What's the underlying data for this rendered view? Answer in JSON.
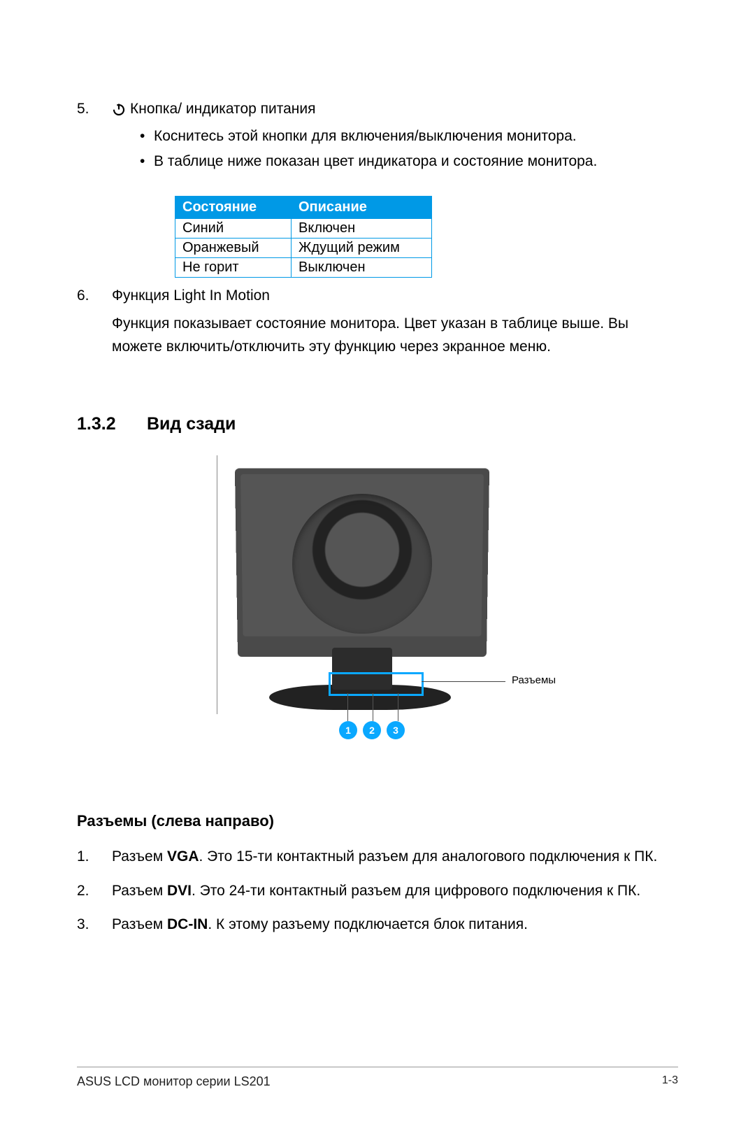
{
  "item5": {
    "num": "5.",
    "title": "Кнопка/ индикатор питания",
    "bullets": [
      "Коснитесь этой кнопки для включения/выключения монитора.",
      "В таблице ниже показан цвет индикатора и состояние монитора."
    ]
  },
  "table": {
    "headers": [
      "Состояние",
      "Описание"
    ],
    "rows": [
      [
        "Синий",
        "Включен"
      ],
      [
        "Оранжевый",
        "Ждущий режим"
      ],
      [
        "Не горит",
        "Выключен"
      ]
    ]
  },
  "item6": {
    "num": "6.",
    "title": "Функция Light In Motion",
    "desc": "Функция показывает состояние монитора. Цвет указан в таблице выше. Вы можете включить/отключить эту функцию через экранное меню."
  },
  "section": {
    "num": "1.3.2",
    "title": "Вид сзади"
  },
  "figure": {
    "callout": "Разъемы",
    "nums": [
      "1",
      "2",
      "3"
    ]
  },
  "connectors": {
    "heading": "Разъемы (слева направо)",
    "items": [
      {
        "num": "1.",
        "prefix": "Разъем ",
        "bold": "VGA",
        "rest": ". Это 15-ти контактный разъем для аналогового подключения к ПК."
      },
      {
        "num": "2.",
        "prefix": "Разъем ",
        "bold": "DVI",
        "rest": ". Это 24-ти контактный разъем для цифрового подключения к ПК."
      },
      {
        "num": "3.",
        "prefix": "Разъем ",
        "bold": "DC-IN",
        "rest": ". К этому разъему подключается блок питания."
      }
    ]
  },
  "footer": {
    "left": "ASUS LCD монитор серии LS201",
    "right": "1-3"
  }
}
